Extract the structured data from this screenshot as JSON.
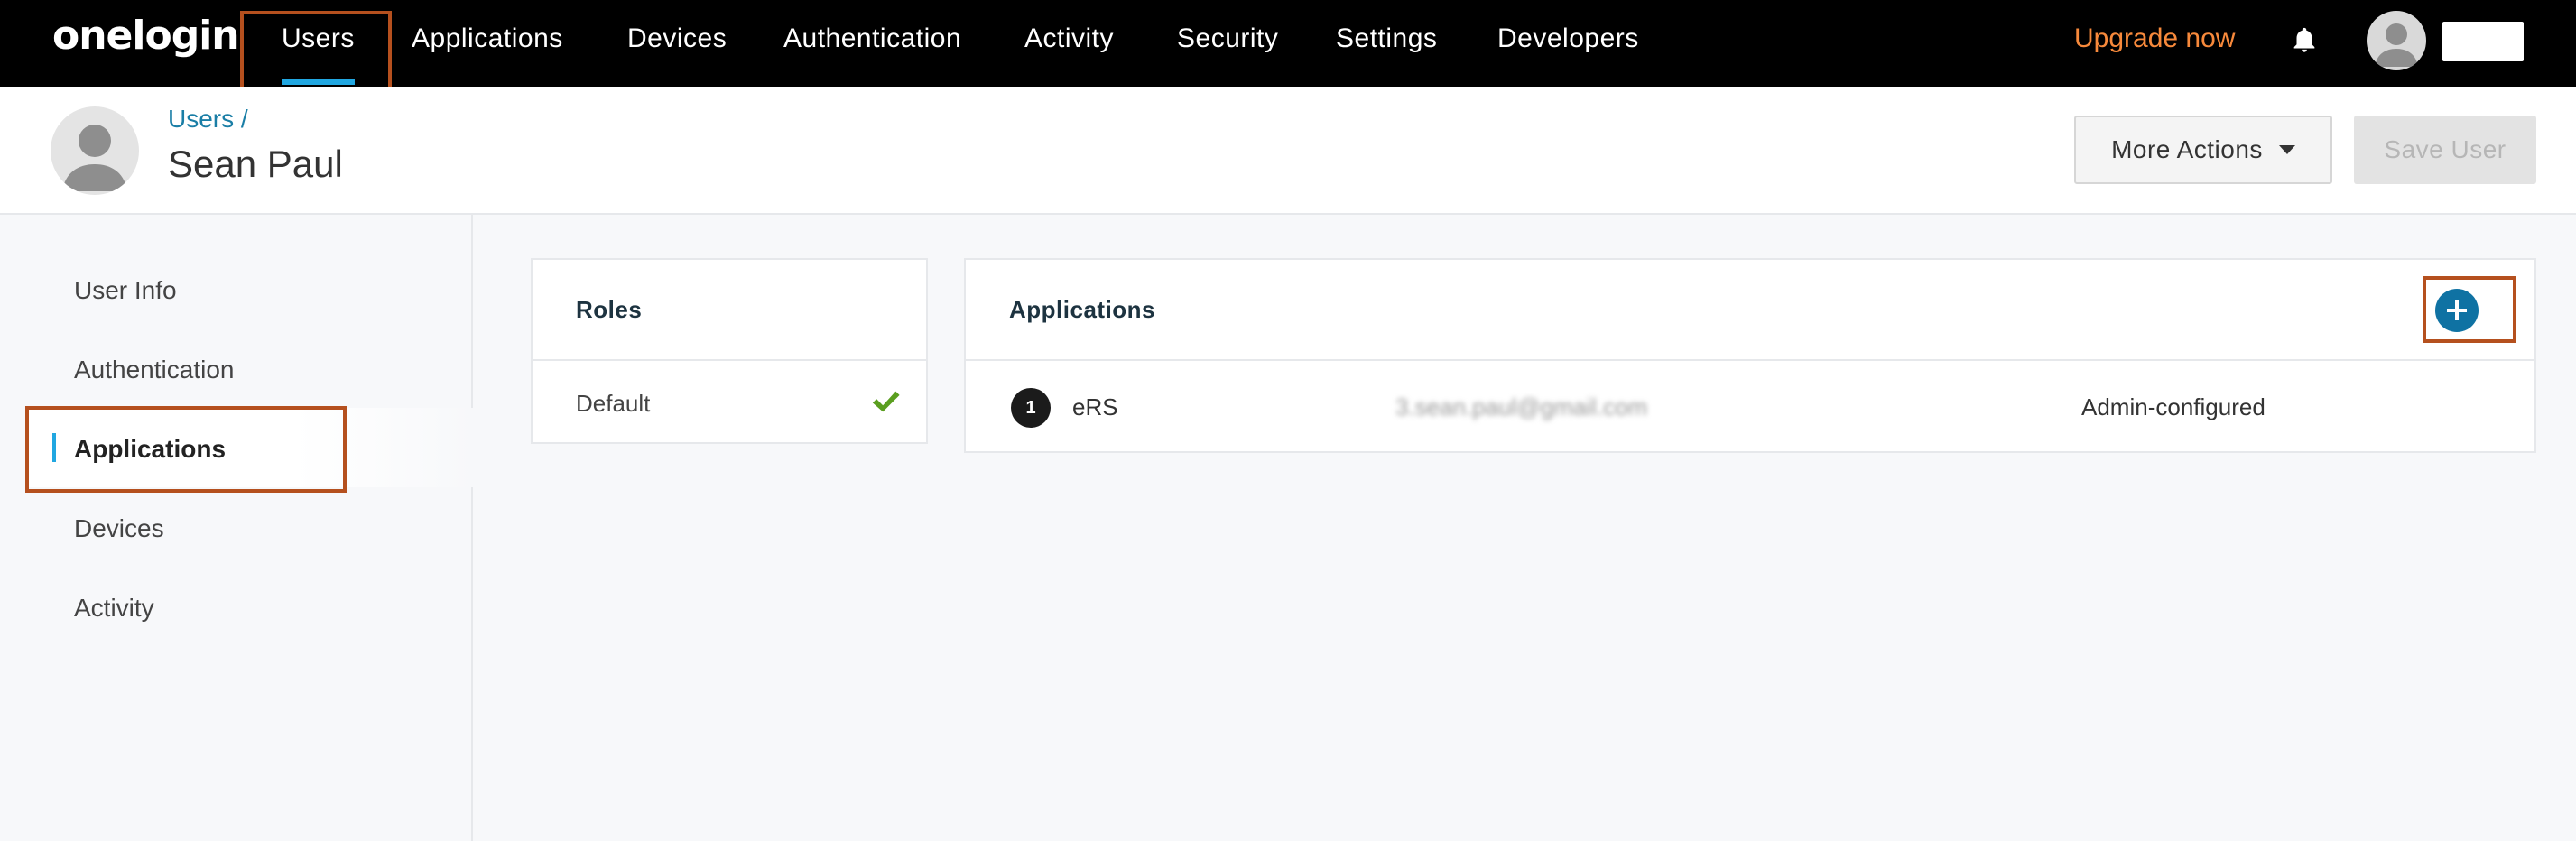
{
  "topnav": {
    "logo": "onelogin",
    "items": [
      "Users",
      "Applications",
      "Devices",
      "Authentication",
      "Activity",
      "Security",
      "Settings",
      "Developers"
    ],
    "upgrade": "Upgrade now",
    "active_item": "Users",
    "colors": {
      "background": "#000000",
      "accent": "#21a7e1",
      "upgrade": "#f7893b"
    },
    "icons": {
      "notifications": "bell-icon",
      "profile": "user-avatar-icon"
    }
  },
  "header": {
    "breadcrumb": "Users /",
    "title": "Sean Paul",
    "more_actions": "More Actions",
    "save_user": "Save User",
    "icons": {
      "user": "user-avatar-icon",
      "dropdown": "caret-down-icon"
    }
  },
  "sidebar": {
    "items": [
      "User Info",
      "Authentication",
      "Applications",
      "Devices",
      "Activity"
    ],
    "active_item": "Applications"
  },
  "roles": {
    "title": "Roles",
    "rows": [
      {
        "name": "Default",
        "icon": "check-icon",
        "icon_color": "#5a9e1f"
      }
    ]
  },
  "applications": {
    "title": "Applications",
    "add_icon": "plus-circle-icon",
    "add_color": "#0f72a3",
    "rows": [
      {
        "icon_text": "1",
        "name": "eRS",
        "email": "3.sean.paul@gmail.com",
        "type": "Admin-configured"
      }
    ]
  },
  "highlight_color": "#b5501e"
}
